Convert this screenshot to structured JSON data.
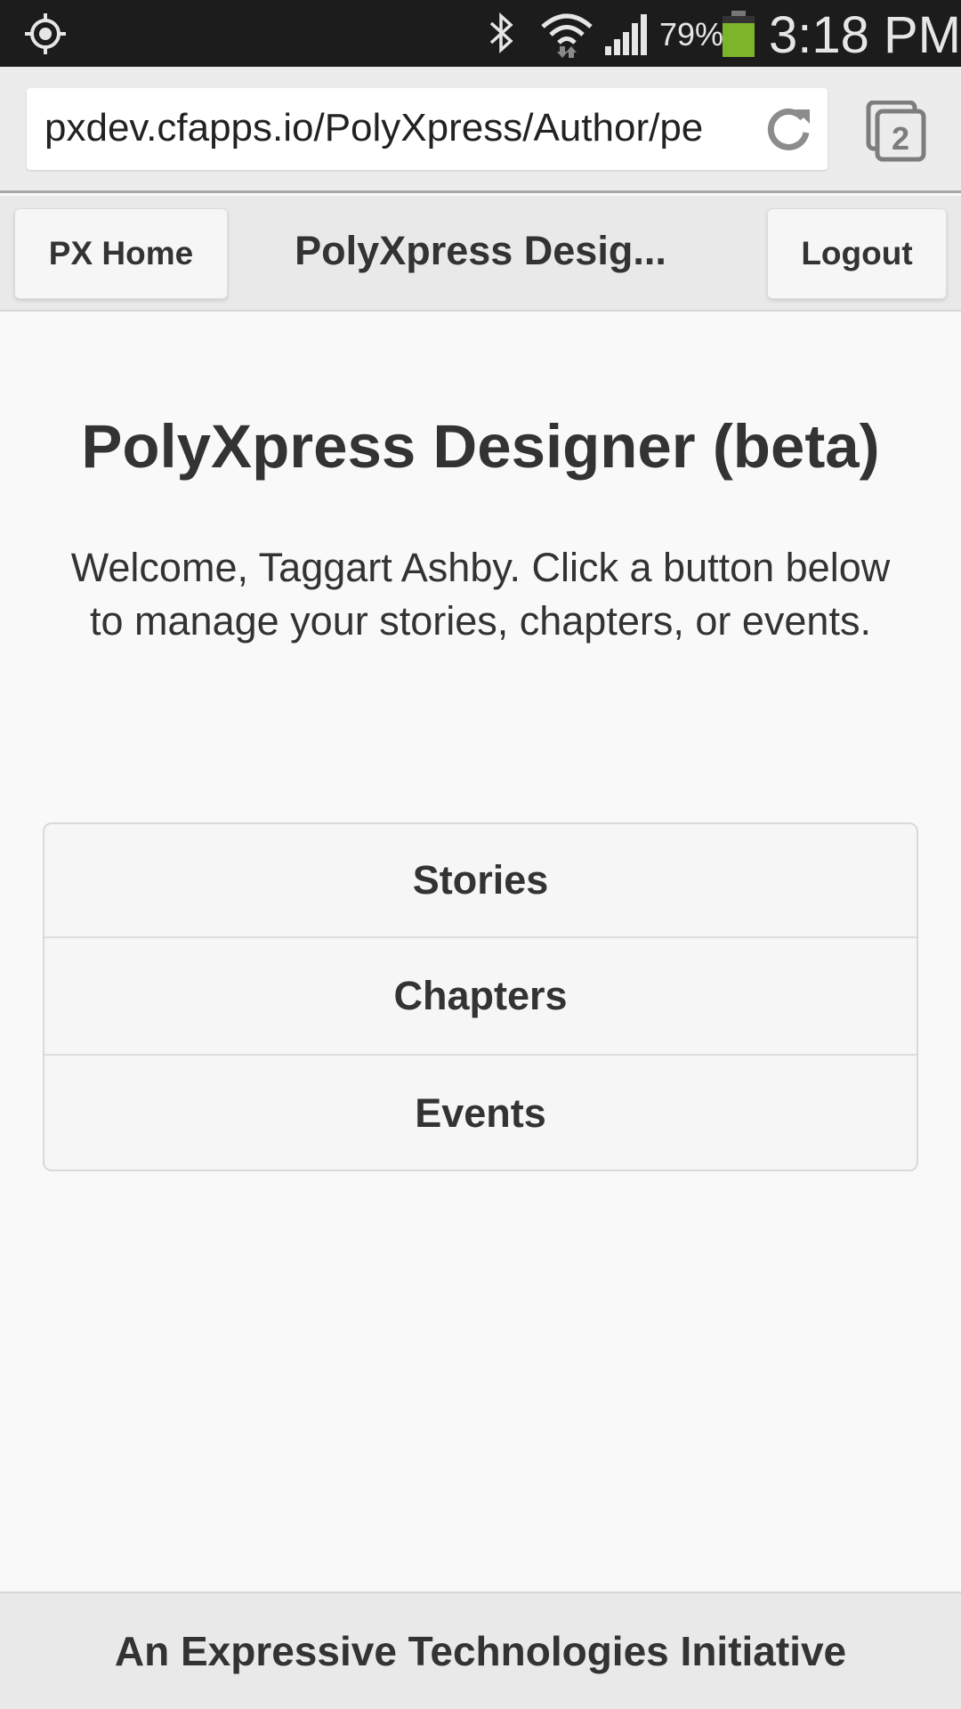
{
  "status_bar": {
    "battery_percent": "79%",
    "time": "3:18 PM",
    "icons": [
      "location-icon",
      "bluetooth-icon",
      "wifi-icon",
      "signal-icon",
      "battery-icon"
    ],
    "battery_color": "#7cb42a"
  },
  "browser": {
    "url": "pxdev.cfapps.io/PolyXpress/Author/pe",
    "tab_count": "2"
  },
  "header": {
    "home_label": "PX Home",
    "title": "PolyXpress Desig...",
    "logout_label": "Logout"
  },
  "main": {
    "title": "PolyXpress Designer (beta)",
    "welcome": "Welcome, Taggart Ashby. Click a button below to manage your stories, chapters, or events.",
    "items": [
      {
        "label": "Stories"
      },
      {
        "label": "Chapters"
      },
      {
        "label": "Events"
      }
    ]
  },
  "footer": {
    "text": "An Expressive Technologies Initiative"
  }
}
